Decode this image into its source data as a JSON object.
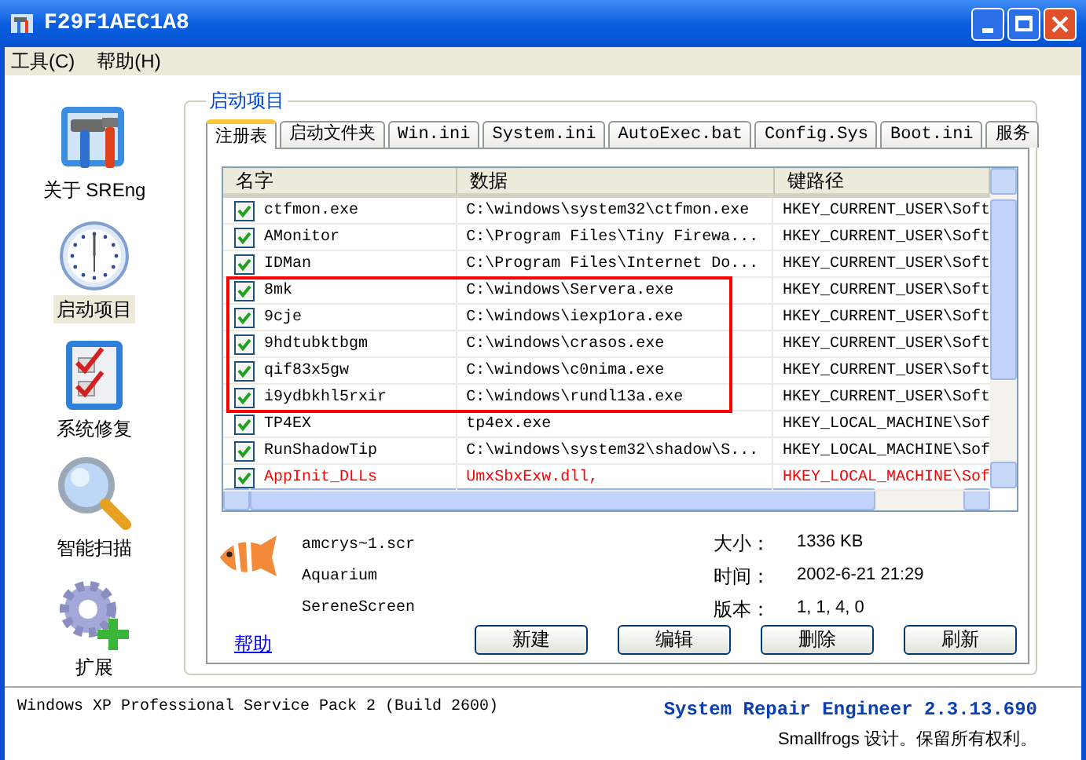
{
  "window": {
    "title": "F29F1AEC1A8"
  },
  "menu": [
    {
      "label": "工具(C)"
    },
    {
      "label": "帮助(H)"
    }
  ],
  "sidebar": {
    "items": [
      {
        "label": "关于 SREng",
        "kind": "tools",
        "selected": false
      },
      {
        "label": "启动项目",
        "kind": "clock",
        "selected": true
      },
      {
        "label": "系统修复",
        "kind": "checklist",
        "selected": false
      },
      {
        "label": "智能扫描",
        "kind": "search",
        "selected": false
      },
      {
        "label": "扩展",
        "kind": "gear",
        "selected": false
      }
    ]
  },
  "group": {
    "title": "启动项目"
  },
  "tabs": [
    {
      "label": "注册表",
      "selected": true
    },
    {
      "label": "启动文件夹",
      "selected": false
    },
    {
      "label": "Win.ini",
      "selected": false
    },
    {
      "label": "System.ini",
      "selected": false
    },
    {
      "label": "AutoExec.bat",
      "selected": false
    },
    {
      "label": "Config.Sys",
      "selected": false
    },
    {
      "label": "Boot.ini",
      "selected": false
    },
    {
      "label": "服务",
      "selected": false
    }
  ],
  "table": {
    "columns": [
      "名字",
      "数据",
      "键路径"
    ],
    "rows": [
      {
        "name": "ctfmon.exe",
        "data": "C:\\windows\\system32\\ctfmon.exe",
        "key": "HKEY_CURRENT_USER\\Soft",
        "checked": true,
        "boxed": false,
        "alert": false
      },
      {
        "name": "AMonitor",
        "data": "C:\\Program Files\\Tiny Firewa...",
        "key": "HKEY_CURRENT_USER\\Soft",
        "checked": true,
        "boxed": false,
        "alert": false
      },
      {
        "name": "IDMan",
        "data": "C:\\Program Files\\Internet Do...",
        "key": "HKEY_CURRENT_USER\\Soft",
        "checked": true,
        "boxed": false,
        "alert": false
      },
      {
        "name": "8mk",
        "data": "C:\\windows\\Servera.exe",
        "key": "HKEY_CURRENT_USER\\Soft",
        "checked": true,
        "boxed": true,
        "alert": false
      },
      {
        "name": "9cje",
        "data": "C:\\windows\\iexp1ora.exe",
        "key": "HKEY_CURRENT_USER\\Soft",
        "checked": true,
        "boxed": true,
        "alert": false
      },
      {
        "name": "9hdtubktbgm",
        "data": "C:\\windows\\crasos.exe",
        "key": "HKEY_CURRENT_USER\\Soft",
        "checked": true,
        "boxed": true,
        "alert": false
      },
      {
        "name": "qif83x5gw",
        "data": "C:\\windows\\c0nima.exe",
        "key": "HKEY_CURRENT_USER\\Soft",
        "checked": true,
        "boxed": true,
        "alert": false
      },
      {
        "name": "i9ydbkhl5rxir",
        "data": "C:\\windows\\rundl13a.exe",
        "key": "HKEY_CURRENT_USER\\Soft",
        "checked": true,
        "boxed": true,
        "alert": false
      },
      {
        "name": "TP4EX",
        "data": "tp4ex.exe",
        "key": "HKEY_LOCAL_MACHINE\\Sof",
        "checked": true,
        "boxed": false,
        "alert": false
      },
      {
        "name": "RunShadowTip",
        "data": "C:\\windows\\system32\\shadow\\S...",
        "key": "HKEY_LOCAL_MACHINE\\Sof",
        "checked": true,
        "boxed": false,
        "alert": false
      },
      {
        "name": "AppInit_DLLs",
        "data": "UmxSbxExw.dll,",
        "key": "HKEY_LOCAL_MACHINE\\Sof",
        "checked": true,
        "boxed": false,
        "alert": true
      }
    ]
  },
  "details": {
    "lines": [
      "amcrys~1.scr",
      "Aquarium",
      "SereneScreen"
    ],
    "props": [
      {
        "label": "大小：",
        "value": "1336 KB"
      },
      {
        "label": "时间：",
        "value": "2002-6-21 21:29"
      },
      {
        "label": "版本：",
        "value": "1, 1, 4, 0"
      }
    ]
  },
  "help_link": "帮助",
  "buttons": [
    "新建",
    "编辑",
    "删除",
    "刷新"
  ],
  "status_bar": {
    "os": "Windows XP Professional Service Pack 2 (Build 2600)",
    "product": "System Repair Engineer 2.3.13.690",
    "copyright": "Smallfrogs 设计。保留所有权利。"
  }
}
